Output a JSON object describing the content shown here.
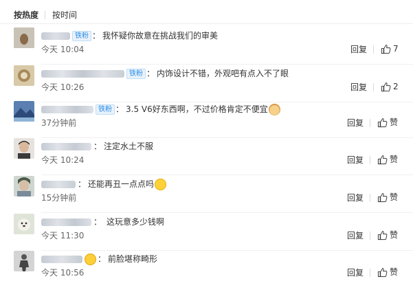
{
  "sort": {
    "hot": "按热度",
    "time": "按时间"
  },
  "comments": [
    {
      "badge": "铁粉",
      "text": "我怀疑你故意在挑战我们的审美",
      "time": "今天 10:04",
      "reply": "回复",
      "likes": "7"
    },
    {
      "badge": "铁粉",
      "text": "内饰设计不错，外观吧有点入不了眼",
      "time": "今天 10:26",
      "reply": "回复",
      "likes": "2"
    },
    {
      "badge": "铁粉",
      "text": "3.5 V6好东西啊，不过价格肯定不便宜",
      "time": "37分钟前",
      "reply": "回复",
      "likes": "赞"
    },
    {
      "text": "注定水土不服",
      "time": "今天 10:24",
      "reply": "回复",
      "likes": "赞"
    },
    {
      "text": "还能再丑一点点吗",
      "time": "15分钟前",
      "reply": "回复",
      "likes": "赞"
    },
    {
      "text": "这玩意多少钱啊",
      "time": "今天 11:30",
      "reply": "回复",
      "likes": "赞"
    },
    {
      "text": "前脸堪称畸形",
      "time": "今天 10:56",
      "reply": "回复",
      "likes": "赞"
    }
  ]
}
